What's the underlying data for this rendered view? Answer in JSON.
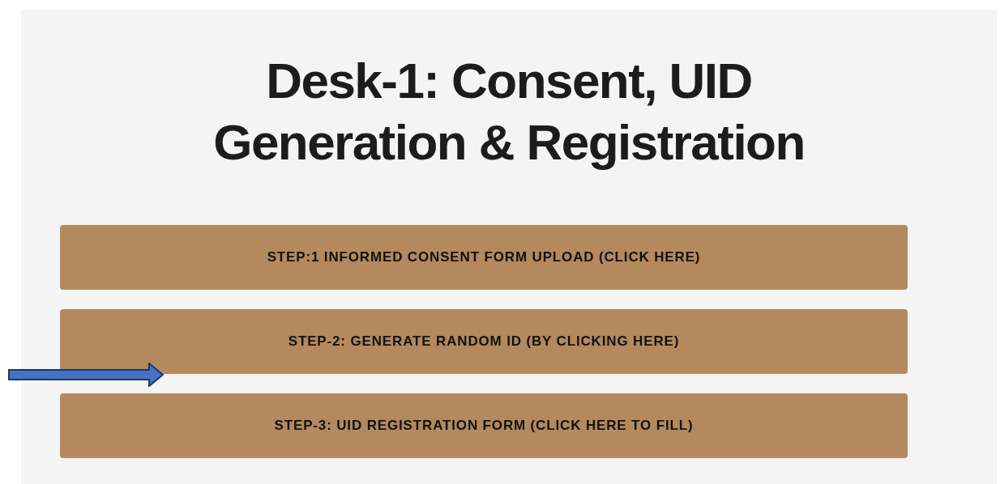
{
  "title": "Desk-1: Consent, UID Generation & Registration",
  "steps": [
    {
      "label": "STEP:1 INFORMED CONSENT FORM UPLOAD (CLICK HERE)"
    },
    {
      "label": "STEP-2: GENERATE RANDOM ID (BY CLICKING HERE)"
    },
    {
      "label": "STEP-3: UID REGISTRATION FORM (CLICK HERE TO FILL)"
    }
  ]
}
